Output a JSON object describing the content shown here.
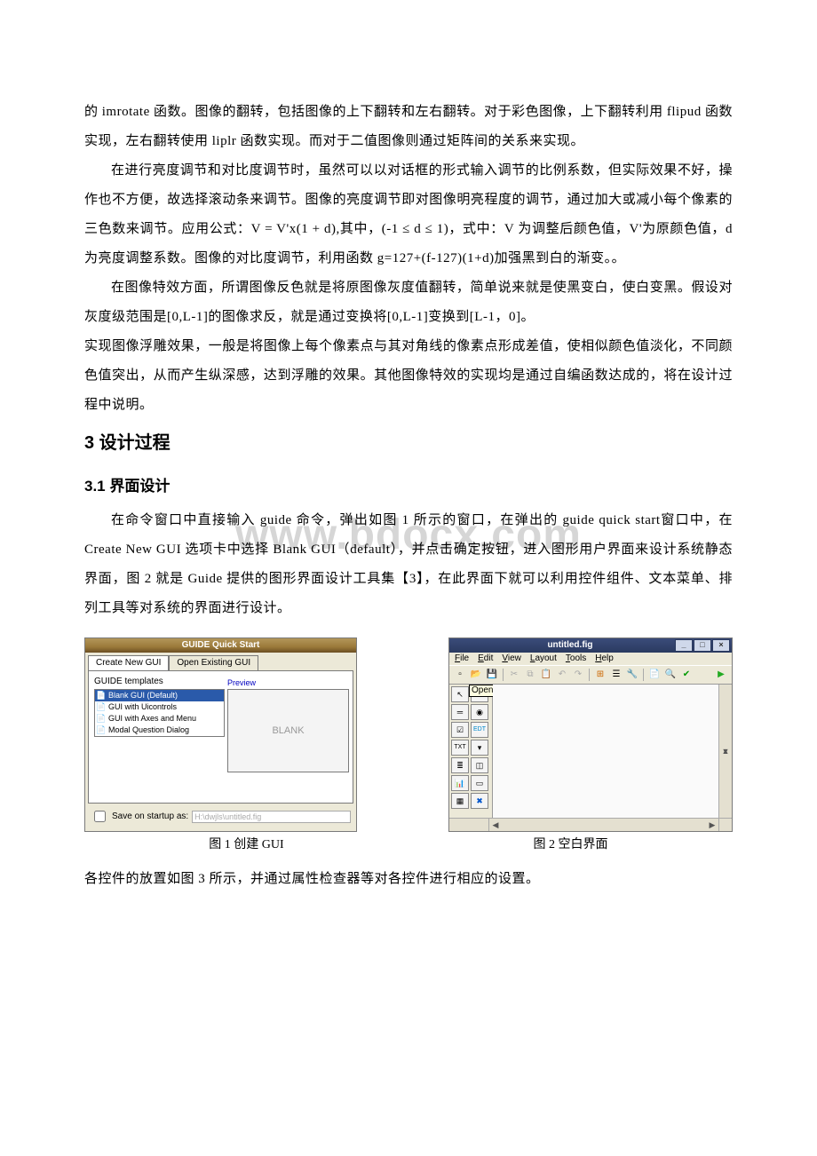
{
  "watermark": "www.bdocx.com",
  "paragraphs": {
    "p1": "的 imrotate 函数。图像的翻转，包括图像的上下翻转和左右翻转。对于彩色图像，上下翻转利用 flipud 函数实现，左右翻转使用 liplr 函数实现。而对于二值图像则通过矩阵间的关系来实现。",
    "p2": "在进行亮度调节和对比度调节时，虽然可以以对话框的形式输入调节的比例系数，但实际效果不好，操作也不方便，故选择滚动条来调节。图像的亮度调节即对图像明亮程度的调节，通过加大或减小每个像素的三色数来调节。应用公式：V = V'x(1 + d),其中，(-1 ≤ d ≤ 1)，式中：V 为调整后颜色值，V'为原颜色值，d 为亮度调整系数。图像的对比度调节，利用函数 g=127+(f-127)(1+d)加强黑到白的渐变。。",
    "p3": "在图像特效方面，所谓图像反色就是将原图像灰度值翻转，简单说来就是使黑变白，使白变黑。假设对灰度级范围是[0,L-1]的图像求反，就是通过变换将[0,L-1]变换到[L-1，0]。",
    "p4": "实现图像浮雕效果，一般是将图像上每个像素点与其对角线的像素点形成差值，使相似颜色值淡化，不同颜色值突出，从而产生纵深感，达到浮雕的效果。其他图像特效的实现均是通过自编函数达成的，将在设计过程中说明。",
    "p5": "在命令窗口中直接输入 guide 命令，弹出如图 1 所示的窗口，在弹出的 guide quick start窗口中，在 Create New GUI 选项卡中选择 Blank GUI（default），并点击确定按钮，进入图形用户界面来设计系统静态界面，图 2 就是 Guide 提供的图形界面设计工具集【3】，在此界面下就可以利用控件组件、文本菜单、排列工具等对系统的界面进行设计。",
    "p6": "各控件的放置如图 3 所示，并通过属性检查器等对各控件进行相应的设置。"
  },
  "headings": {
    "h2": "3 设计过程",
    "h3": "3.1 界面设计"
  },
  "fig1": {
    "title": "GUIDE Quick Start",
    "tab_new": "Create New GUI",
    "tab_open": "Open Existing GUI",
    "templates_label": "GUIDE templates",
    "templates": {
      "t0": "Blank GUI (Default)",
      "t1": "GUI with Uicontrols",
      "t2": "GUI with Axes and Menu",
      "t3": "Modal Question Dialog"
    },
    "preview_label": "Preview",
    "preview_content": "BLANK",
    "save_label": "Save on startup as:",
    "save_path": "H:\\dwjls\\untitled.fig"
  },
  "fig2": {
    "title": "untitled.fig",
    "menu": {
      "m0": "File",
      "m1": "Edit",
      "m2": "View",
      "m3": "Layout",
      "m4": "Tools",
      "m5": "Help"
    },
    "tooltip": "Open"
  },
  "captions": {
    "c1": "图 1   创建 GUI",
    "c2": "图 2   空白界面"
  }
}
